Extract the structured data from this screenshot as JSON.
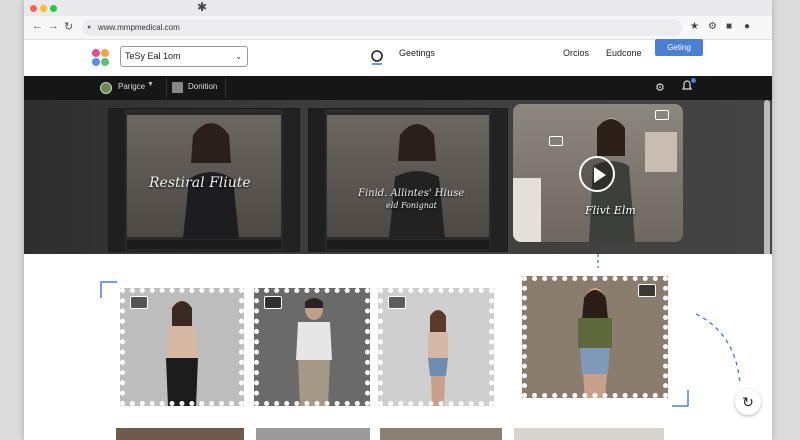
{
  "browser": {
    "url": "www.mmpmedical.com",
    "new_tab_glyph": "✱"
  },
  "header": {
    "search_value": "TeSy Eal 1om",
    "nav_center_label": "Geetings",
    "nav_links": [
      "Orcios",
      "Eudcone"
    ],
    "cta_label": "Geting"
  },
  "toolbar": {
    "profile_label": "Parigce",
    "section_label": "Donition"
  },
  "hero": {
    "caption_left": "Restiral Fliute",
    "caption_mid_line1": "Finid. Allintes' Hiuse",
    "caption_mid_line2": "eld Fonignat",
    "card_caption": "Flivt Elm"
  },
  "colors": {
    "accent": "#4a7fd4",
    "toolbar_bg": "#161616",
    "hero_bg": "#3a3a3a"
  },
  "icons": [
    "back-icon",
    "forward-icon",
    "reload-icon",
    "lock-icon",
    "star-icon",
    "extension-icon",
    "menu-icon",
    "logo-icon",
    "gear-icon",
    "bell-icon",
    "play-icon",
    "refresh-icon"
  ]
}
